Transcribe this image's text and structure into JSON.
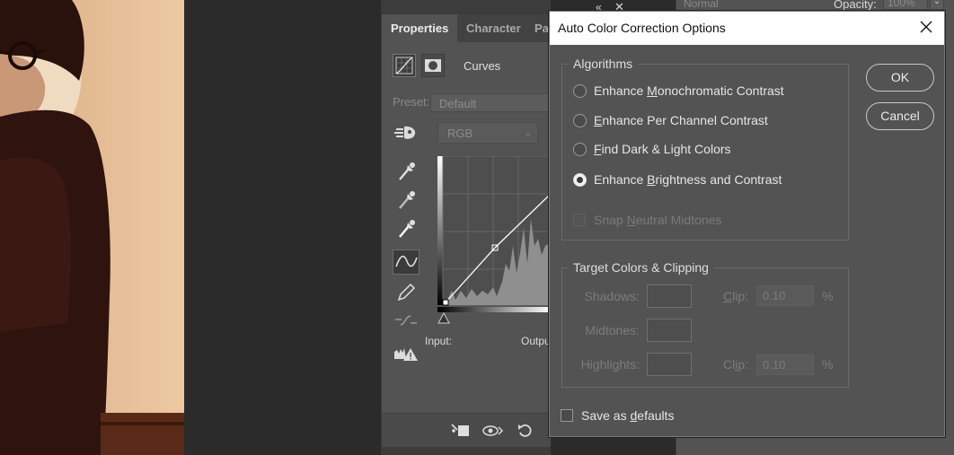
{
  "properties_panel": {
    "tabs": [
      "Properties",
      "Character",
      "Par"
    ],
    "adjustment_label": "Curves",
    "preset_label": "Preset:",
    "preset_value": "Default",
    "channel_value": "RGB",
    "input_label": "Input:",
    "output_label": "Outpu"
  },
  "layers_strip": {
    "blend_mode": "Normal",
    "opacity_label": "Opacity:",
    "opacity_value": "100%"
  },
  "dialog": {
    "title": "Auto Color Correction Options",
    "algorithms": {
      "title": "Algorithms",
      "options": [
        {
          "label": "Enhance Monochromatic Contrast",
          "selected": false
        },
        {
          "label": "Enhance Per Channel Contrast",
          "selected": false
        },
        {
          "label": "Find Dark & Light Colors",
          "selected": false
        },
        {
          "label": "Enhance Brightness and Contrast",
          "selected": true
        }
      ],
      "snap_label": "Snap Neutral Midtones",
      "snap_checked": false,
      "snap_enabled": false
    },
    "target": {
      "title": "Target Colors & Clipping",
      "shadows_label": "Shadows:",
      "midtones_label": "Midtones:",
      "highlights_label": "Highlights:",
      "clip_label": "Clip:",
      "shadows_clip": "0.10",
      "highlights_clip": "0.10",
      "percent": "%"
    },
    "save_defaults_label": "Save as defaults",
    "save_defaults_checked": false,
    "ok_label": "OK",
    "cancel_label": "Cancel"
  },
  "colors": {
    "panel_bg": "#535353",
    "titlebar_bg": "#ffffff",
    "photo_tone": "#e5be96"
  }
}
